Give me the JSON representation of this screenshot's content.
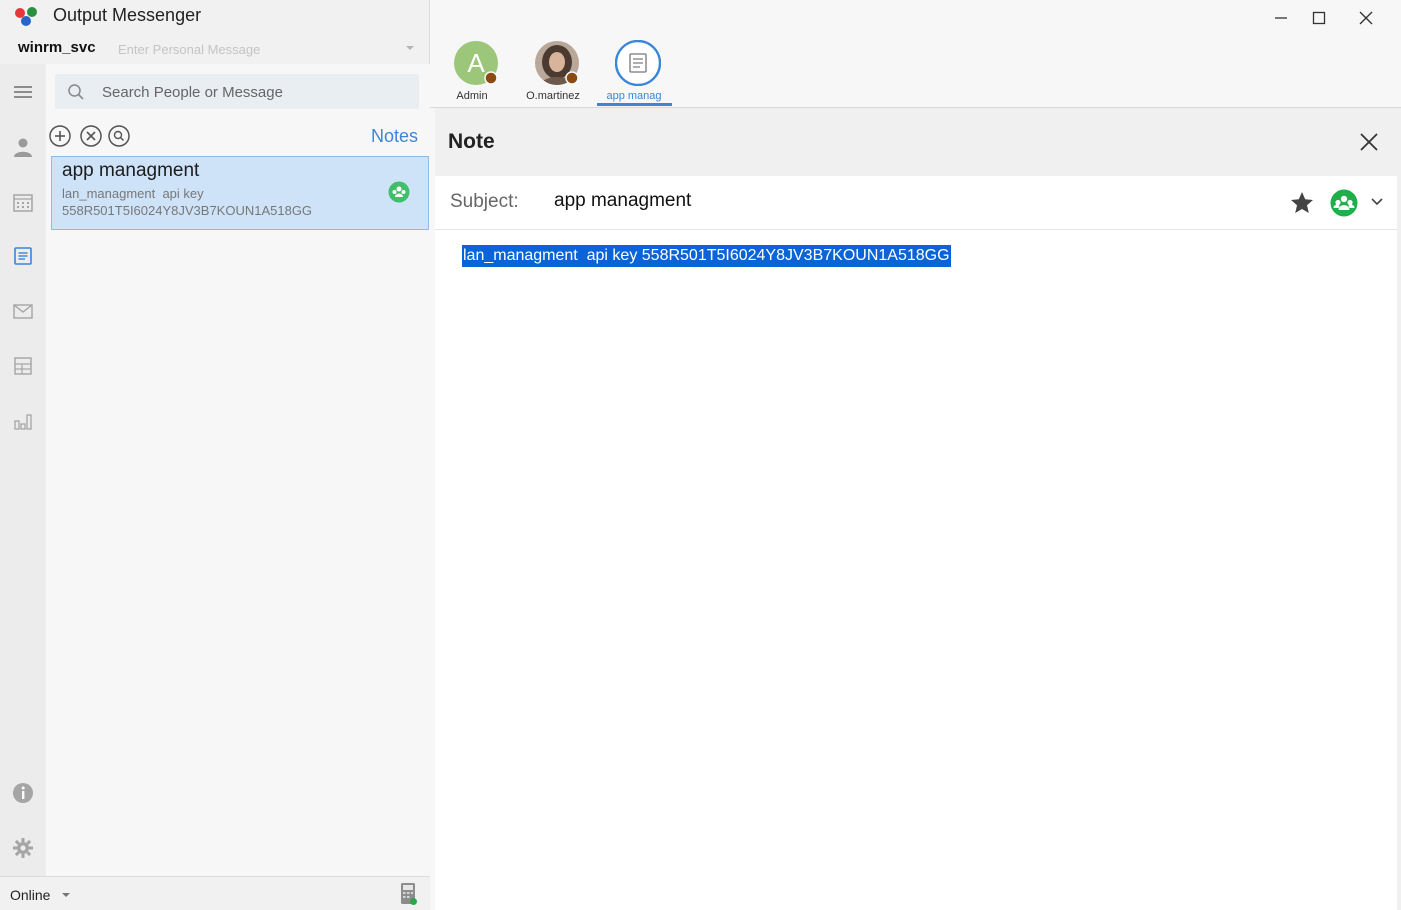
{
  "app": {
    "title": "Output Messenger",
    "username": "winrm_svc",
    "personal_message_placeholder": "Enter Personal Message"
  },
  "nav": [
    {
      "name": "menu-icon",
      "label": "Menu"
    },
    {
      "name": "contacts-icon",
      "label": "Contacts"
    },
    {
      "name": "calendar-icon",
      "label": "Calendar"
    },
    {
      "name": "notes-icon",
      "label": "Notes",
      "active": true
    },
    {
      "name": "mail-icon",
      "label": "Mail"
    },
    {
      "name": "dashboard-icon",
      "label": "Dashboard"
    },
    {
      "name": "reports-icon",
      "label": "Reports"
    }
  ],
  "search": {
    "placeholder": "Search People or Message"
  },
  "notes_list": {
    "section_title": "Notes",
    "items": [
      {
        "title": "app managment",
        "preview_line1": "lan_managment  api key",
        "preview_line2": "558R501T5I6024Y8JV3B7KOUN1A518GG",
        "shared": true
      }
    ]
  },
  "status": {
    "text": "Online"
  },
  "chat_tabs": [
    {
      "label": "Admin",
      "initial": "A",
      "type": "user",
      "status_color": "#8a4a12"
    },
    {
      "label": "O.martinez",
      "initial": "",
      "type": "user-photo",
      "status_color": "#8a4a12"
    },
    {
      "label": "app manag",
      "initial": "",
      "type": "note",
      "active": true
    }
  ],
  "note": {
    "heading": "Note",
    "subject_label": "Subject:",
    "subject_value": "app managment",
    "body_text": "lan_managment  api key 558R501T5I6024Y8JV3B7KOUN1A518GG",
    "starred": false
  },
  "colors": {
    "accent": "#3b86d6",
    "selection": "#0a64d8",
    "share_green": "#1fae4a",
    "admin_avatar": "#9cc77a",
    "list_selected": "#cfe3f8"
  }
}
